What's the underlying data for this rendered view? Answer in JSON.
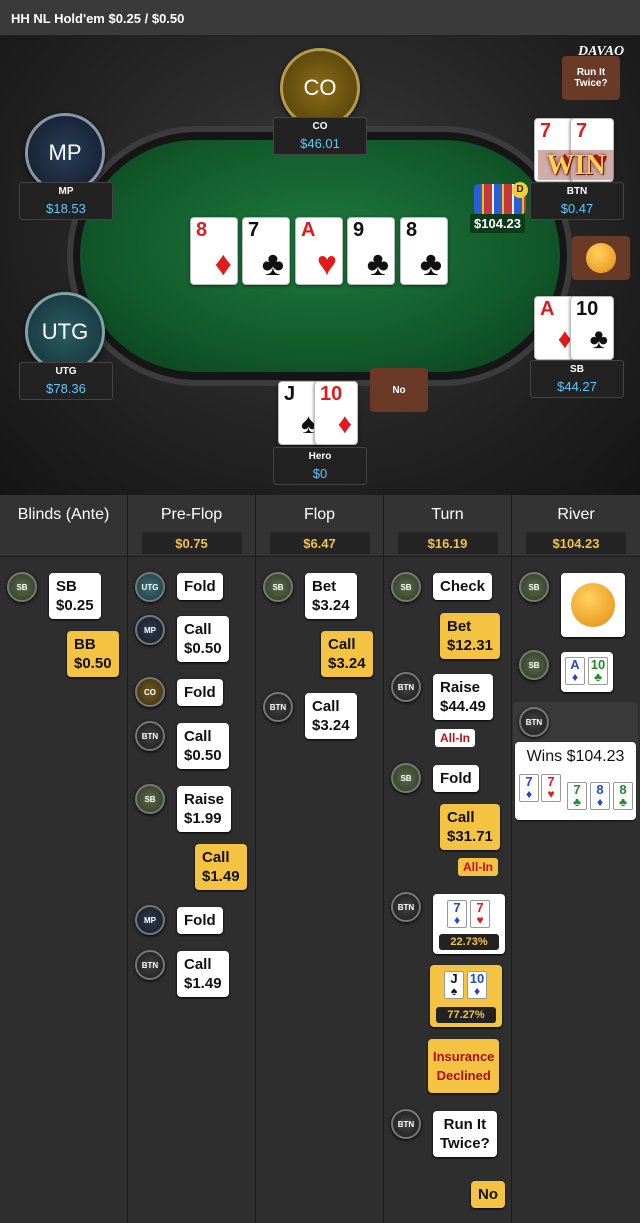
{
  "title": "HH NL Hold'em $0.25 / $0.50",
  "table": {
    "logo": "DAVAO",
    "pot": "$104.23",
    "board": [
      {
        "rank": "8",
        "suit": "♦",
        "color": "red"
      },
      {
        "rank": "7",
        "suit": "♣",
        "color": "blk"
      },
      {
        "rank": "A",
        "suit": "♥",
        "color": "red"
      },
      {
        "rank": "9",
        "suit": "♣",
        "color": "blk"
      },
      {
        "rank": "8",
        "suit": "♣",
        "color": "blk"
      }
    ],
    "seats": {
      "co": {
        "avatar": "CO",
        "name": "CO",
        "stack": "$46.01"
      },
      "mp": {
        "avatar": "MP",
        "name": "MP",
        "stack": "$18.53"
      },
      "utg": {
        "avatar": "UTG",
        "name": "UTG",
        "stack": "$78.36"
      },
      "btn": {
        "name": "BTN",
        "stack": "$0.47",
        "cards": [
          {
            "rank": "7",
            "suit": "♦",
            "color": "red"
          },
          {
            "rank": "7",
            "suit": "♥",
            "color": "red"
          }
        ],
        "win": "WIN"
      },
      "sb": {
        "name": "SB",
        "stack": "$44.27",
        "cards": [
          {
            "rank": "A",
            "suit": "♦",
            "color": "red"
          },
          {
            "rank": "10",
            "suit": "♣",
            "color": "blk"
          }
        ]
      },
      "hero": {
        "name": "Hero",
        "stack": "$0",
        "cards": [
          {
            "rank": "J",
            "suit": "♠",
            "color": "blk"
          },
          {
            "rank": "10",
            "suit": "♦",
            "color": "red"
          }
        ]
      }
    },
    "bubbles": {
      "run_it_twice": "Run It Twice?",
      "no": "No"
    }
  },
  "history": {
    "columns": [
      {
        "title": "Blinds (Ante)",
        "pot": ""
      },
      {
        "title": "Pre-Flop",
        "pot": "$0.75"
      },
      {
        "title": "Flop",
        "pot": "$6.47"
      },
      {
        "title": "Turn",
        "pot": "$16.19"
      },
      {
        "title": "River",
        "pot": "$104.23"
      }
    ],
    "blinds": [
      {
        "badge": "SB",
        "text": "SB\n$0.25"
      },
      {
        "badge": "",
        "text": "BB\n$0.50"
      }
    ],
    "preflop": [
      {
        "badge": "UTG",
        "text": "Fold"
      },
      {
        "badge": "MP",
        "text": "Call\n$0.50"
      },
      {
        "badge": "CO",
        "text": "Fold"
      },
      {
        "badge": "BTN",
        "text": "Call\n$0.50"
      },
      {
        "badge": "SB",
        "text": "Raise\n$1.99"
      },
      {
        "badge": "",
        "text": "Call\n$1.49"
      },
      {
        "badge": "MP",
        "text": "Fold"
      },
      {
        "badge": "BTN",
        "text": "Call\n$1.49"
      }
    ],
    "flop": [
      {
        "badge": "SB",
        "text": "Bet\n$3.24"
      },
      {
        "badge": "",
        "text": "Call\n$3.24"
      },
      {
        "badge": "BTN",
        "text": "Call\n$3.24"
      }
    ],
    "turn": [
      {
        "badge": "SB",
        "text": "Check"
      },
      {
        "badge": "",
        "text": "Bet\n$12.31"
      },
      {
        "badge": "BTN",
        "text": "Raise\n$44.49"
      },
      {
        "tag": "All-In"
      },
      {
        "badge": "SB",
        "text": "Fold"
      },
      {
        "badge": "",
        "text": "Call\n$31.71"
      },
      {
        "tag": "All-In"
      },
      {
        "badge": "BTN",
        "equity": "22.73%",
        "cards": [
          {
            "rank": "7",
            "suit": "♦",
            "color": "blu"
          },
          {
            "rank": "7",
            "suit": "♥",
            "color": "red"
          }
        ]
      },
      {
        "badge": "",
        "equity": "77.27%",
        "cards": [
          {
            "rank": "J",
            "suit": "♠",
            "color": "blk"
          },
          {
            "rank": "10",
            "suit": "♦",
            "color": "blu"
          }
        ]
      },
      {
        "badge": "",
        "text": "Insurance\nDeclined"
      },
      {
        "badge": "BTN",
        "text": "Run It\nTwice?"
      },
      {
        "badge": "",
        "text": "No"
      }
    ],
    "river": {
      "sb_badge": "SB",
      "btn_badge": "BTN",
      "sb_cards": [
        {
          "rank": "A",
          "suit": "♦",
          "color": "blu"
        },
        {
          "rank": "10",
          "suit": "♣",
          "color": "grn"
        }
      ],
      "wins": "Wins $104.23",
      "win_cards": [
        {
          "rank": "7",
          "suit": "♦",
          "color": "blu"
        },
        {
          "rank": "7",
          "suit": "♥",
          "color": "red"
        },
        {
          "rank": "7",
          "suit": "♣",
          "color": "grn"
        },
        {
          "rank": "8",
          "suit": "♦",
          "color": "blu"
        },
        {
          "rank": "8",
          "suit": "♣",
          "color": "grn"
        }
      ]
    }
  }
}
